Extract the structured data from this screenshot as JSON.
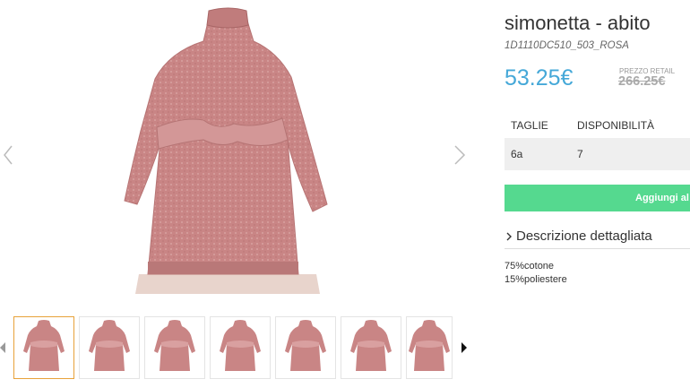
{
  "product": {
    "title": "simonetta - abito",
    "sku": "1D1110DC510_503_ROSA",
    "price": "53.25€",
    "retail_label": "PREZZO RETAIL",
    "retail_price": "266.25€"
  },
  "sizes": {
    "headers": [
      "TAGLIE",
      "DISPONIBILITÀ"
    ],
    "rows": [
      {
        "size": "6a",
        "availability": "7"
      }
    ]
  },
  "actions": {
    "add_label": "Aggiungi al c"
  },
  "description": {
    "toggle_label": "Descrizione dettagliata",
    "composition": [
      "75%cotone",
      "15%poliestere"
    ]
  },
  "gallery": {
    "thumbnail_count": 7,
    "active_thumbnail": 1
  },
  "colors": {
    "price": "#45a8d8",
    "add_button": "#55d98f",
    "active_thumb_border": "#e8a23a",
    "dress": "#c98585"
  },
  "icons": {
    "prev": "chevron-left-icon",
    "next": "chevron-right-icon",
    "desc": "chevron-right-icon"
  }
}
